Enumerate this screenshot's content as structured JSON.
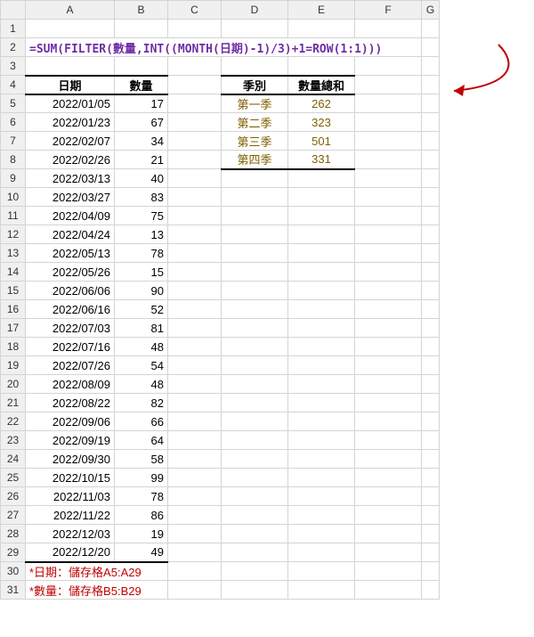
{
  "columns": [
    "A",
    "B",
    "C",
    "D",
    "E",
    "F",
    "G"
  ],
  "formula": "=SUM(FILTER(數量,INT((MONTH(日期)-1)/3)+1=ROW(1:1)))",
  "headers_left": {
    "date": "日期",
    "qty": "數量"
  },
  "headers_right": {
    "quarter": "季別",
    "sum": "數量總和"
  },
  "rows_left": [
    {
      "r": 5,
      "d": "2022/01/05",
      "q": "17"
    },
    {
      "r": 6,
      "d": "2022/01/23",
      "q": "67"
    },
    {
      "r": 7,
      "d": "2022/02/07",
      "q": "34"
    },
    {
      "r": 8,
      "d": "2022/02/26",
      "q": "21"
    },
    {
      "r": 9,
      "d": "2022/03/13",
      "q": "40"
    },
    {
      "r": 10,
      "d": "2022/03/27",
      "q": "83"
    },
    {
      "r": 11,
      "d": "2022/04/09",
      "q": "75"
    },
    {
      "r": 12,
      "d": "2022/04/24",
      "q": "13"
    },
    {
      "r": 13,
      "d": "2022/05/13",
      "q": "78"
    },
    {
      "r": 14,
      "d": "2022/05/26",
      "q": "15"
    },
    {
      "r": 15,
      "d": "2022/06/06",
      "q": "90"
    },
    {
      "r": 16,
      "d": "2022/06/16",
      "q": "52"
    },
    {
      "r": 17,
      "d": "2022/07/03",
      "q": "81"
    },
    {
      "r": 18,
      "d": "2022/07/16",
      "q": "48"
    },
    {
      "r": 19,
      "d": "2022/07/26",
      "q": "54"
    },
    {
      "r": 20,
      "d": "2022/08/09",
      "q": "48"
    },
    {
      "r": 21,
      "d": "2022/08/22",
      "q": "82"
    },
    {
      "r": 22,
      "d": "2022/09/06",
      "q": "66"
    },
    {
      "r": 23,
      "d": "2022/09/19",
      "q": "64"
    },
    {
      "r": 24,
      "d": "2022/09/30",
      "q": "58"
    },
    {
      "r": 25,
      "d": "2022/10/15",
      "q": "99"
    },
    {
      "r": 26,
      "d": "2022/11/03",
      "q": "78"
    },
    {
      "r": 27,
      "d": "2022/11/22",
      "q": "86"
    },
    {
      "r": 28,
      "d": "2022/12/03",
      "q": "19"
    },
    {
      "r": 29,
      "d": "2022/12/20",
      "q": "49"
    }
  ],
  "rows_right": [
    {
      "r": 5,
      "quarter": "第一季",
      "sum": "262"
    },
    {
      "r": 6,
      "quarter": "第二季",
      "sum": "323"
    },
    {
      "r": 7,
      "quarter": "第三季",
      "sum": "501"
    },
    {
      "r": 8,
      "quarter": "第四季",
      "sum": "331"
    }
  ],
  "notes": {
    "n1": "*日期：儲存格A5:A29",
    "n2": "*數量：儲存格B5:B29"
  },
  "chart_data": {
    "type": "table",
    "tables": [
      {
        "title": "日期/數量",
        "columns": [
          "日期",
          "數量"
        ],
        "rows": [
          [
            "2022/01/05",
            17
          ],
          [
            "2022/01/23",
            67
          ],
          [
            "2022/02/07",
            34
          ],
          [
            "2022/02/26",
            21
          ],
          [
            "2022/03/13",
            40
          ],
          [
            "2022/03/27",
            83
          ],
          [
            "2022/04/09",
            75
          ],
          [
            "2022/04/24",
            13
          ],
          [
            "2022/05/13",
            78
          ],
          [
            "2022/05/26",
            15
          ],
          [
            "2022/06/06",
            90
          ],
          [
            "2022/06/16",
            52
          ],
          [
            "2022/07/03",
            81
          ],
          [
            "2022/07/16",
            48
          ],
          [
            "2022/07/26",
            54
          ],
          [
            "2022/08/09",
            48
          ],
          [
            "2022/08/22",
            82
          ],
          [
            "2022/09/06",
            66
          ],
          [
            "2022/09/19",
            64
          ],
          [
            "2022/09/30",
            58
          ],
          [
            "2022/10/15",
            99
          ],
          [
            "2022/11/03",
            78
          ],
          [
            "2022/11/22",
            86
          ],
          [
            "2022/12/03",
            19
          ],
          [
            "2022/12/20",
            49
          ]
        ]
      },
      {
        "title": "季別/數量總和",
        "columns": [
          "季別",
          "數量總和"
        ],
        "rows": [
          [
            "第一季",
            262
          ],
          [
            "第二季",
            323
          ],
          [
            "第三季",
            501
          ],
          [
            "第四季",
            331
          ]
        ]
      }
    ]
  }
}
